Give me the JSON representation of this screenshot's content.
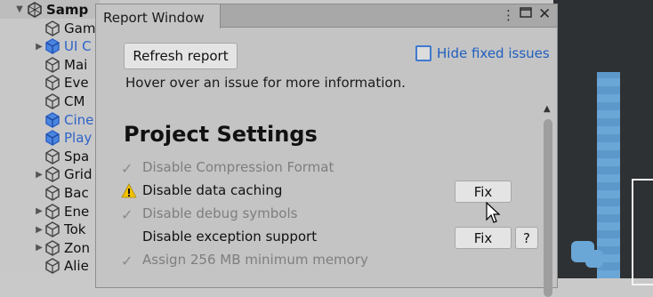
{
  "hierarchy": {
    "root_label": "Samp",
    "items": [
      {
        "label": "Gam",
        "blue": false,
        "expand": false
      },
      {
        "label": "UI C",
        "blue": true,
        "expand": true
      },
      {
        "label": "Mai",
        "blue": false,
        "expand": false
      },
      {
        "label": "Eve",
        "blue": false,
        "expand": false
      },
      {
        "label": "CM",
        "blue": false,
        "expand": false
      },
      {
        "label": "Cine",
        "blue": true,
        "expand": false
      },
      {
        "label": "Play",
        "blue": true,
        "expand": false
      },
      {
        "label": "Spa",
        "blue": false,
        "expand": false
      },
      {
        "label": "Grid",
        "blue": false,
        "expand": true
      },
      {
        "label": "Bac",
        "blue": false,
        "expand": false
      },
      {
        "label": "Ene",
        "blue": false,
        "expand": true
      },
      {
        "label": "Tok",
        "blue": false,
        "expand": true
      },
      {
        "label": "Zon",
        "blue": false,
        "expand": true
      },
      {
        "label": "Alie",
        "blue": false,
        "expand": false
      }
    ]
  },
  "window": {
    "title": "Report Window",
    "refresh_label": "Refresh report",
    "hide_fixed_label": "Hide fixed issues",
    "hide_fixed_checked": false,
    "hint": "Hover over an issue for more information.",
    "section_title": "Project Settings",
    "fix_label": "Fix",
    "help_label": "?",
    "issues": [
      {
        "label": "Disable Compression Format",
        "state": "done"
      },
      {
        "label": "Disable data caching",
        "state": "warning"
      },
      {
        "label": "Disable debug symbols",
        "state": "done"
      },
      {
        "label": "Disable exception support",
        "state": "open"
      },
      {
        "label": "Assign 256 MB minimum memory",
        "state": "done"
      }
    ]
  },
  "colors": {
    "accent": "#3f79cf",
    "link": "#1f5fbf",
    "warning": "#f2c200"
  }
}
